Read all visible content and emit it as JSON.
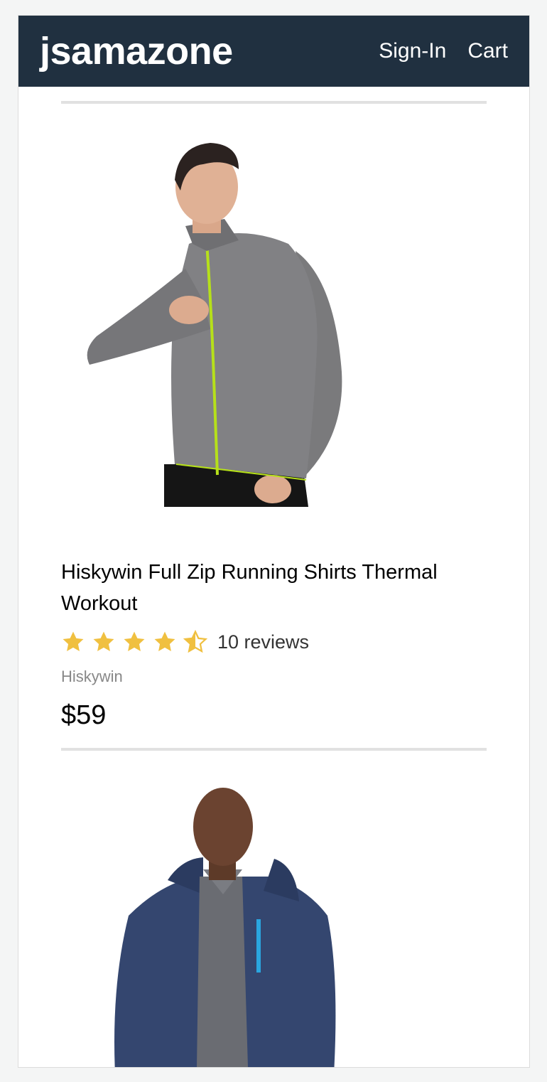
{
  "header": {
    "brand": "jsamazone",
    "sign_in": "Sign-In",
    "cart": "Cart"
  },
  "colors": {
    "header_bg": "#203040",
    "star": "#f0c040",
    "divider": "#e1e1e1"
  },
  "products": [
    {
      "name": "Hiskywin Full Zip Running Shirts Thermal Workout",
      "rating": 4.5,
      "reviews": "10 reviews",
      "brand": "Hiskywin",
      "price": "$59",
      "image": "grey-zip-running-shirt-photo"
    },
    {
      "image": "navy-hooded-jacket-photo"
    }
  ]
}
